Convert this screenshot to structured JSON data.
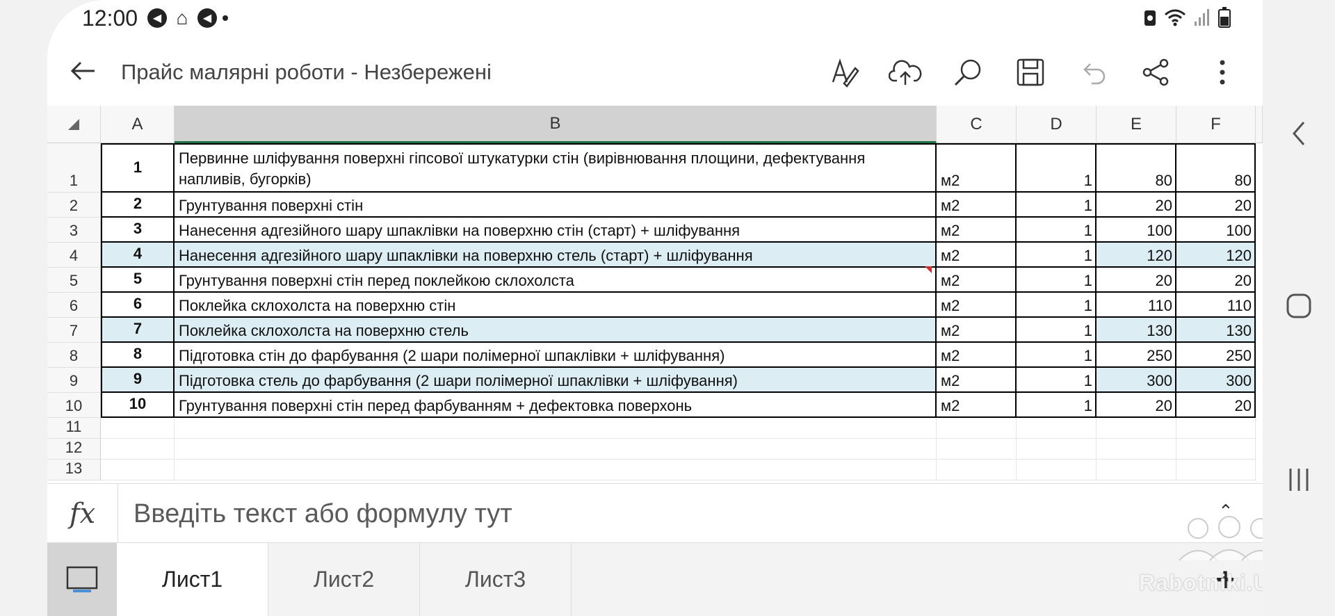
{
  "status": {
    "time": "12:00"
  },
  "title": "Прайс малярні роботи - Незбережені",
  "columns": [
    "A",
    "B",
    "C",
    "D",
    "E",
    "F"
  ],
  "rows": [
    {
      "num": "1",
      "a": "1",
      "b": "Первинне шліфування поверхні гіпсової штукатурки стін (вирівнювання площини, дефектування напливів, бугорків)",
      "c": "м2",
      "d": "1",
      "e": "80",
      "f": "80"
    },
    {
      "num": "2",
      "a": "2",
      "b": "Грунтування поверхні стін",
      "c": "м2",
      "d": "1",
      "e": "20",
      "f": "20"
    },
    {
      "num": "3",
      "a": "3",
      "b": "Нанесення адгезійного шару шпаклівки на поверхню стін (старт) + шліфування",
      "c": "м2",
      "d": "1",
      "e": "100",
      "f": "100"
    },
    {
      "num": "4",
      "a": "4",
      "b": "Нанесення адгезійного шару шпаклівки на поверхню стель (старт) + шліфування",
      "c": "м2",
      "d": "1",
      "e": "120",
      "f": "120"
    },
    {
      "num": "5",
      "a": "5",
      "b": "Грунтування поверхні стін перед поклейкою склохолста",
      "c": "м2",
      "d": "1",
      "e": "20",
      "f": "20"
    },
    {
      "num": "6",
      "a": "6",
      "b": "Поклейка склохолста на поверхню стін",
      "c": "м2",
      "d": "1",
      "e": "110",
      "f": "110"
    },
    {
      "num": "7",
      "a": "7",
      "b": "Поклейка склохолста на поверхню стель",
      "c": "м2",
      "d": "1",
      "e": "130",
      "f": "130"
    },
    {
      "num": "8",
      "a": "8",
      "b": "Підготовка стін до фарбування (2 шари полімерної шпаклівки + шліфування)",
      "c": "м2",
      "d": "1",
      "e": "250",
      "f": "250"
    },
    {
      "num": "9",
      "a": "9",
      "b": "Підготовка стель до фарбування (2 шари полімерної шпаклівки + шліфування)",
      "c": "м2",
      "d": "1",
      "e": "300",
      "f": "300"
    },
    {
      "num": "10",
      "a": "10",
      "b": "Грунтування поверхні стін перед фарбуванням + дефектовка поверхонь",
      "c": "м2",
      "d": "1",
      "e": "20",
      "f": "20"
    }
  ],
  "empty_rows": [
    "11",
    "12",
    "13"
  ],
  "formula": {
    "placeholder": "Введіть текст або формулу тут"
  },
  "tabs": [
    "Лист1",
    "Лист2",
    "Лист3"
  ],
  "watermark": "Rabotniki.UA"
}
